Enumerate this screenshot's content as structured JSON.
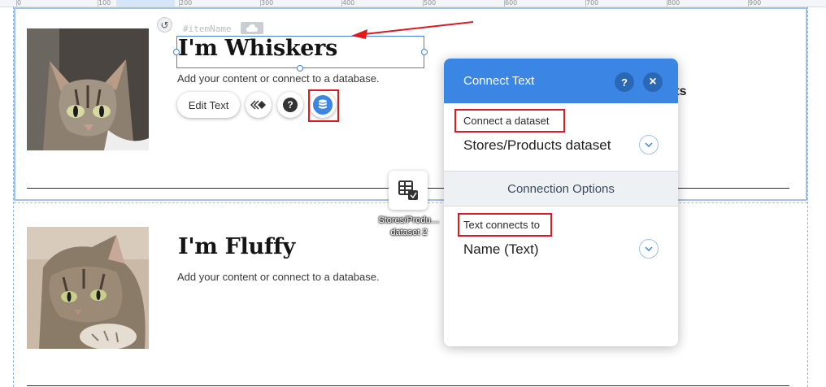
{
  "ruler": {
    "labels": [
      "0",
      "100",
      "200",
      "300",
      "400",
      "500",
      "600",
      "700",
      "800",
      "900"
    ]
  },
  "items": [
    {
      "item_name_tag": "#itemName",
      "title": "I'm Whiskers",
      "subtitle": "Add your content or connect to a database."
    },
    {
      "title": "I'm Fluffy",
      "subtitle": "Add your content or connect to a database."
    }
  ],
  "background_text": "ists",
  "toolbar": {
    "edit_text_label": "Edit Text",
    "animation_icon": "diamond-arrow-icon",
    "help_icon": "question-icon",
    "connect_icon": "database-icon"
  },
  "dataset_element": {
    "label": "Stores/Produ…\ndataset 2",
    "icon": "dataset-table-icon"
  },
  "connect_panel": {
    "title": "Connect Text",
    "help_label": "?",
    "close_label": "×",
    "dataset_section": {
      "label": "Connect a dataset",
      "value": "Stores/Products dataset"
    },
    "options_header": "Connection Options",
    "text_section": {
      "label": "Text connects to",
      "value": "Name (Text)"
    }
  },
  "colors": {
    "accent": "#3b86e4",
    "annotation_red": "#e0191d",
    "selection": "#9cc3ee"
  }
}
